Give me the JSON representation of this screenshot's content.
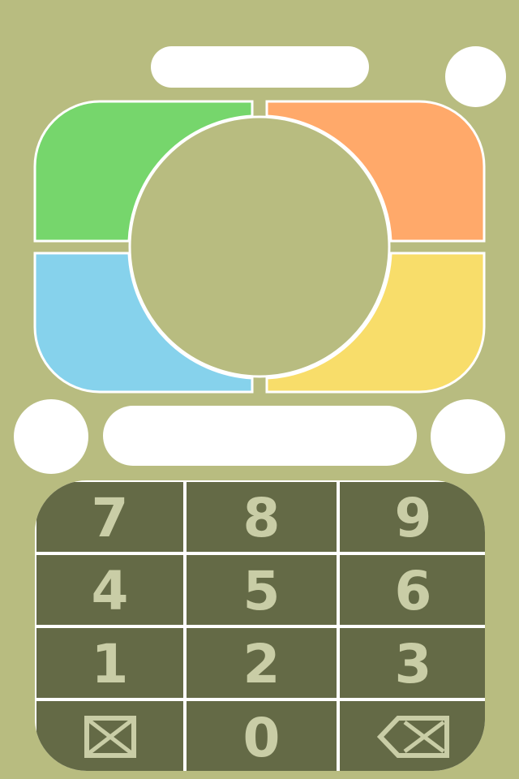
{
  "colors": {
    "background": "#b8bc80",
    "outline": "#ffffff",
    "dpad_up_left": "#76d66c",
    "dpad_up_right": "#ffa96a",
    "dpad_down_left": "#86d2ec",
    "dpad_down_right": "#f8dd6a",
    "keypad_key": "#646a46",
    "keypad_text": "#c9cda6"
  },
  "keypad": {
    "rows": [
      [
        "7",
        "8",
        "9"
      ],
      [
        "4",
        "5",
        "6"
      ],
      [
        "1",
        "2",
        "3"
      ]
    ],
    "bottom": {
      "left_icon": "clear-box-icon",
      "center": "0",
      "right_icon": "backspace-icon"
    }
  },
  "dpad": {
    "segments": [
      "up-left",
      "up-right",
      "down-left",
      "down-right"
    ],
    "center": "center-button"
  }
}
